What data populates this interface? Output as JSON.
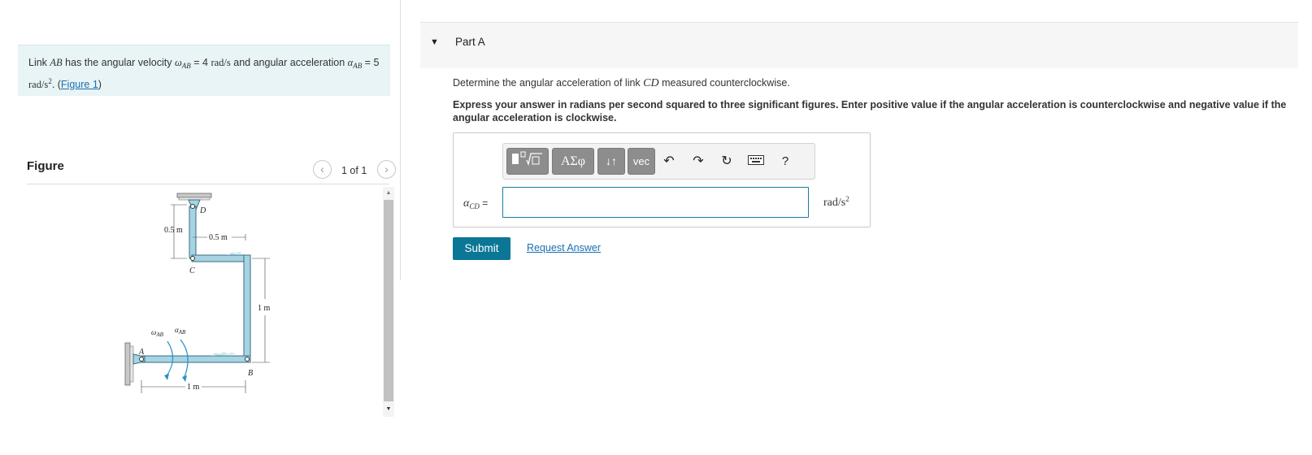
{
  "problem": {
    "text_1": "Link ",
    "link_name": "AB",
    "text_2": " has the angular velocity ",
    "omega_symbol": "ω",
    "omega_sub": "AB",
    "text_3": " = 4 ",
    "omega_unit": "rad/s",
    "text_4": " and angular acceleration ",
    "alpha_symbol": "α",
    "alpha_sub": "AB",
    "text_5": " = 5 ",
    "alpha_unit": "rad/s",
    "alpha_unit_exp": "2",
    "text_6": ". (",
    "figure_link": "Figure 1",
    "text_7": ")"
  },
  "figure": {
    "title": "Figure",
    "counter": "1 of 1",
    "labels": {
      "point_d": "D",
      "point_c": "C",
      "point_a": "A",
      "point_b": "B",
      "dim_vertical_cd": "0.5 m",
      "dim_horizontal_cd": "0.5 m",
      "dim_vertical_bc": "1 m",
      "dim_horizontal_ab": "1 m",
      "omega_label": "ω",
      "omega_label_sub": "AB",
      "alpha_label": "α",
      "alpha_label_sub": "AB"
    }
  },
  "part": {
    "label": "Part A",
    "instruction_1a": "Determine the angular acceleration of link ",
    "instruction_1_link": "CD",
    "instruction_1b": " measured counterclockwise.",
    "instruction_2": "Express your answer in radians per second squared to three significant figures. Enter positive value if the angular acceleration is counterclockwise and negative value if the angular acceleration is clockwise."
  },
  "toolbar": {
    "greek_label": "ΑΣφ",
    "arrows_label": "↓↑",
    "vec_label": "vec",
    "help_label": "?"
  },
  "answer": {
    "label_symbol": "α",
    "label_sub": "CD",
    "label_eq": " =",
    "value": "",
    "units": "rad/s",
    "units_exp": "2"
  },
  "actions": {
    "submit": "Submit",
    "request_answer": "Request Answer"
  },
  "colors": {
    "accent": "#0b7696",
    "problem_bg": "#e8f4f6",
    "link_fill": "#a7d4e3",
    "link_stroke": "#3a6c82"
  }
}
